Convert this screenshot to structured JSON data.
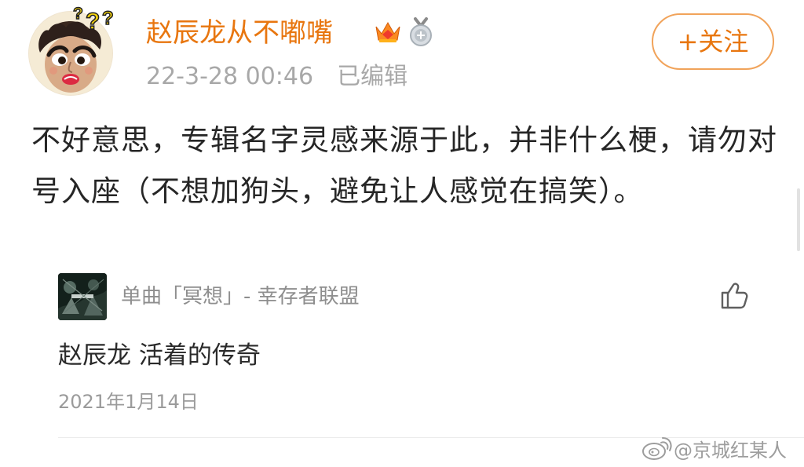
{
  "post": {
    "username": "赵辰龙从不嘟嘴",
    "timestamp": "22-3-28 00:46",
    "edited_label": "已编辑",
    "follow_label": "+关注",
    "text": "不好意思，专辑名字灵感来源于此，并非什么梗，请勿对号入座（不想加狗头，避免让人感觉在搞笑）。",
    "badges": [
      "crown-icon",
      "medal-icon"
    ]
  },
  "music_card": {
    "title": "单曲「冥想」- 幸存者联盟",
    "album_icon": "album-cover"
  },
  "comment": {
    "text": "赵辰龙 活着的传奇",
    "date": "2021年1月14日",
    "like_icon": "thumbs-up-icon"
  },
  "watermark": {
    "text": "@京城红某人",
    "icon": "weibo-icon"
  },
  "colors": {
    "brand_orange": "#e8760f",
    "text_primary": "#262626",
    "text_secondary": "#a8a8a8"
  }
}
